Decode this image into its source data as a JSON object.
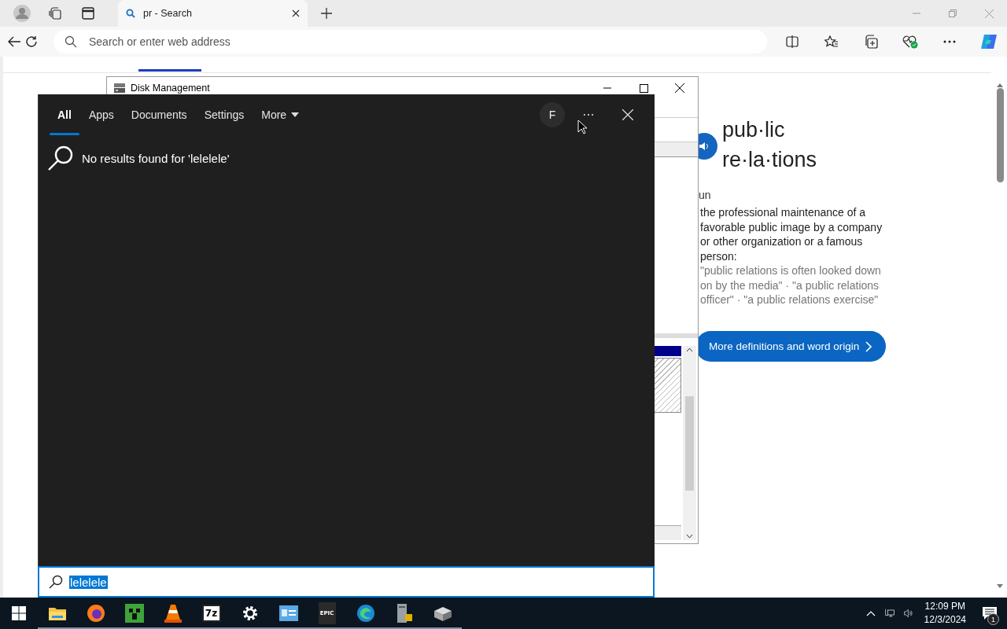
{
  "browser": {
    "tab": {
      "title": "pr - Search"
    },
    "address_bar": {
      "placeholder": "Search or enter web address"
    }
  },
  "dictionary": {
    "headword_lines": [
      "pub·lic",
      "re·la·tions"
    ],
    "part_of_speech": "un",
    "definition": "the professional maintenance of a favorable public image by a company or other organization or a famous person:",
    "examples": "\"public relations is often looked down on by the media\" · \"a public relations officer\" · \"a public relations exercise\"",
    "more_button": "More definitions and word origin"
  },
  "disk_window": {
    "title": "Disk Management"
  },
  "search_panel": {
    "tabs": [
      {
        "label": "All",
        "selected": true,
        "dropdown": false
      },
      {
        "label": "Apps",
        "selected": false,
        "dropdown": false
      },
      {
        "label": "Documents",
        "selected": false,
        "dropdown": false
      },
      {
        "label": "Settings",
        "selected": false,
        "dropdown": false
      },
      {
        "label": "More",
        "selected": false,
        "dropdown": true
      }
    ],
    "avatar": "F",
    "more_options": "···",
    "message": "No results found for 'lelelele'",
    "query": {
      "value": "lelelele"
    }
  },
  "taskbar": {
    "apps": [
      {
        "kind": "folder"
      },
      {
        "kind": "browser"
      },
      {
        "kind": "block"
      },
      {
        "kind": "cone"
      },
      {
        "kind": "archive",
        "glyph": "7z"
      },
      {
        "kind": "gear"
      },
      {
        "kind": "card"
      },
      {
        "kind": "epic",
        "glyph": "EPIC"
      },
      {
        "kind": "edge"
      },
      {
        "kind": "server"
      },
      {
        "kind": "drive"
      }
    ],
    "time": "12:09 PM",
    "date": "12/3/2024",
    "notification_count": "1"
  }
}
